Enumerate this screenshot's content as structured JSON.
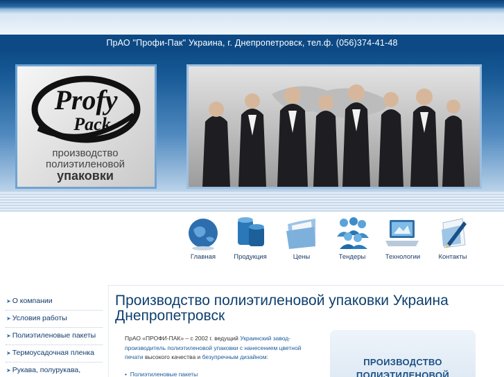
{
  "header": {
    "info": "ПрАО \"Профи-Пак\" Украина, г. Днепропетровск, тел.ф. (056)374-41-48"
  },
  "logo": {
    "brand_line1": "Profy",
    "brand_line2": "Pack",
    "tagline": [
      "производство",
      "полиэтиленовой",
      "упаковки"
    ]
  },
  "nav": {
    "items": [
      {
        "label": "Главная",
        "icon": "globe-icon"
      },
      {
        "label": "Продукция",
        "icon": "film-roll-icon"
      },
      {
        "label": "Цены",
        "icon": "folder-icon"
      },
      {
        "label": "Тендеры",
        "icon": "people-group-icon"
      },
      {
        "label": "Технологии",
        "icon": "laptop-icon"
      },
      {
        "label": "Контакты",
        "icon": "pen-paper-icon"
      }
    ]
  },
  "sidebar": {
    "items": [
      {
        "label": "О компании"
      },
      {
        "label": "Условия работы"
      },
      {
        "label": "Полиэтиленовые пакеты"
      },
      {
        "label": "Термоусадочная пленка"
      },
      {
        "label": "Рукава, полурукава, полотно"
      }
    ]
  },
  "main": {
    "title": "Производство полиэтиленовой упаковки Украина Днепропетровск",
    "intro_a": "ПрАО «ПРОФИ-ПАК» – с 2002 г. ведущий ",
    "intro_b": "Украинский завод-производитель полиэтиленовой упаковки с нанесением цветной печати",
    "intro_c": "  высокого качества и ",
    "intro_d": "безупречным дизайном",
    "intro_e": ":",
    "bullet": "Полиэтиленовые пакеты"
  },
  "promo": {
    "line1": "ПРОИЗВОДСТВО",
    "line2": "ПОЛИЭТИЛЕНОВОЙ"
  },
  "colors": {
    "header_blue": "#0d4a85",
    "link_blue": "#103a6d",
    "title_blue": "#0e3f6e"
  }
}
